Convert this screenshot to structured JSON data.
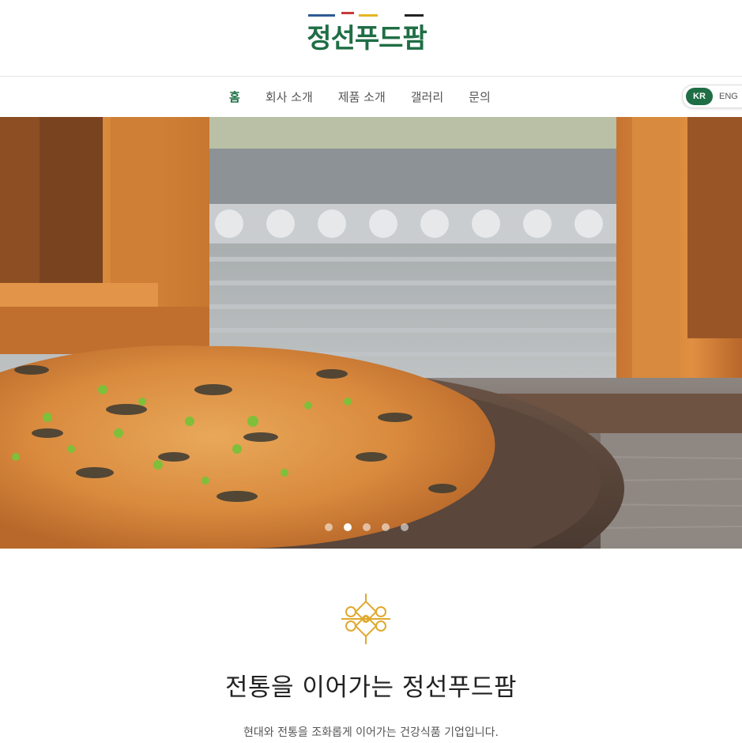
{
  "brand": {
    "logo_text": "정선푸드팜",
    "bar_colors": [
      "#2e5a93",
      "#c83a3a",
      "#e7b521",
      "#222222"
    ],
    "primary_color": "#1f6e45",
    "accent_color": "#e0a92e"
  },
  "nav": {
    "items": [
      {
        "label": "홈",
        "active": true
      },
      {
        "label": "회사 소개",
        "active": false
      },
      {
        "label": "제품 소개",
        "active": false
      },
      {
        "label": "갤러리",
        "active": false
      },
      {
        "label": "문의",
        "active": false
      }
    ],
    "lang": {
      "kr": "KR",
      "en": "ENG",
      "selected": "KR"
    }
  },
  "hero": {
    "image": "korean-pancake-on-wooden-plate",
    "slide_count": 5,
    "active_slide": 2
  },
  "intro": {
    "icon": "knot-ornament-icon",
    "title": "전통을 이어가는 정선푸드팜",
    "text": "현대와 전통을 조화롭게 이어가는 건강식품 기업입니다."
  }
}
